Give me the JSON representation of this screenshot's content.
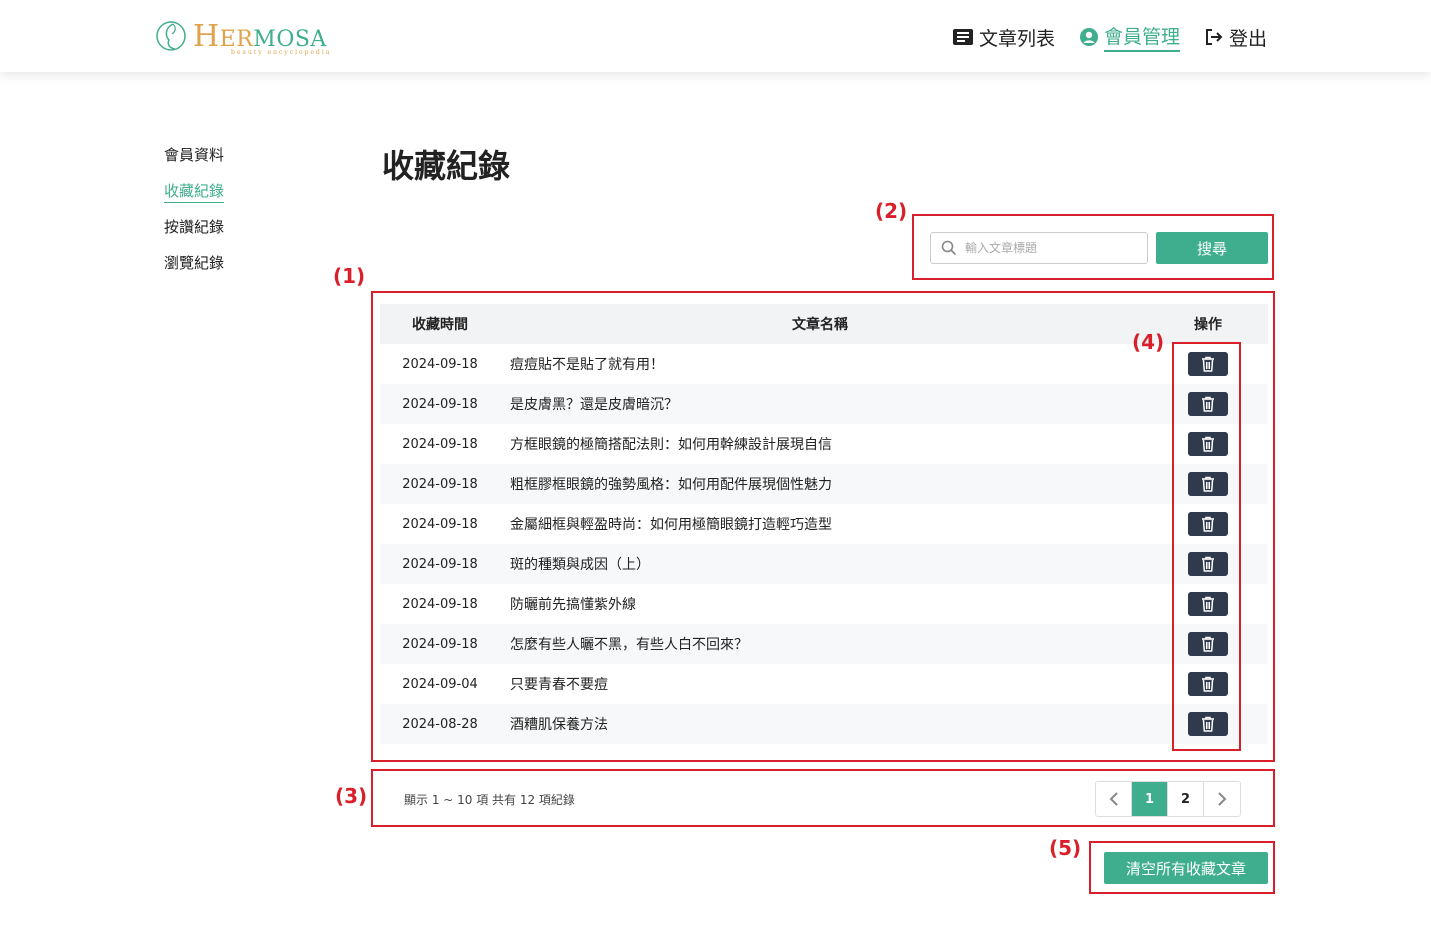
{
  "brand": {
    "name_initial": "H",
    "name_mid": "ER",
    "name_rest": "MOSA",
    "tagline": "beauty encyclopedia"
  },
  "nav": {
    "items": [
      {
        "label": "文章列表",
        "icon": "book-icon"
      },
      {
        "label": "會員管理",
        "icon": "user-circle-icon"
      },
      {
        "label": "登出",
        "icon": "logout-icon"
      }
    ]
  },
  "sidebar": {
    "items": [
      {
        "label": "會員資料"
      },
      {
        "label": "收藏紀錄"
      },
      {
        "label": "按讚紀錄"
      },
      {
        "label": "瀏覽紀錄"
      }
    ]
  },
  "page": {
    "title": "收藏紀錄"
  },
  "search": {
    "placeholder": "輸入文章標題",
    "button_label": "搜尋",
    "icon": "search-icon"
  },
  "table": {
    "headers": {
      "date": "收藏時間",
      "name": "文章名稱",
      "action": "操作"
    },
    "rows": [
      {
        "date": "2024-09-18",
        "title": "痘痘貼不是貼了就有用！"
      },
      {
        "date": "2024-09-18",
        "title": "是皮膚黑？還是皮膚暗沉？"
      },
      {
        "date": "2024-09-18",
        "title": "方框眼鏡的極簡搭配法則：如何用幹練設計展現自信"
      },
      {
        "date": "2024-09-18",
        "title": "粗框膠框眼鏡的強勢風格：如何用配件展現個性魅力"
      },
      {
        "date": "2024-09-18",
        "title": "金屬細框與輕盈時尚：如何用極簡眼鏡打造輕巧造型"
      },
      {
        "date": "2024-09-18",
        "title": "斑的種類與成因（上）"
      },
      {
        "date": "2024-09-18",
        "title": "防曬前先搞懂紫外線"
      },
      {
        "date": "2024-09-18",
        "title": "怎麼有些人曬不黑，有些人白不回來？"
      },
      {
        "date": "2024-09-04",
        "title": "只要青春不要痘"
      },
      {
        "date": "2024-08-28",
        "title": "酒糟肌保養方法"
      }
    ]
  },
  "pagination": {
    "info": "顯示 1 ~ 10 項 共有 12 項紀錄",
    "pages": [
      "1",
      "2"
    ],
    "current": "1"
  },
  "actions": {
    "clear_all_label": "清空所有收藏文章"
  },
  "annotations": [
    "(1)",
    "(2)",
    "(3)",
    "(4)",
    "(5)"
  ],
  "colors": {
    "accent": "#3fae8e",
    "dark_button": "#2f3a4c",
    "annotation": "#d9202a",
    "logo_gold": "#e0a24a"
  }
}
